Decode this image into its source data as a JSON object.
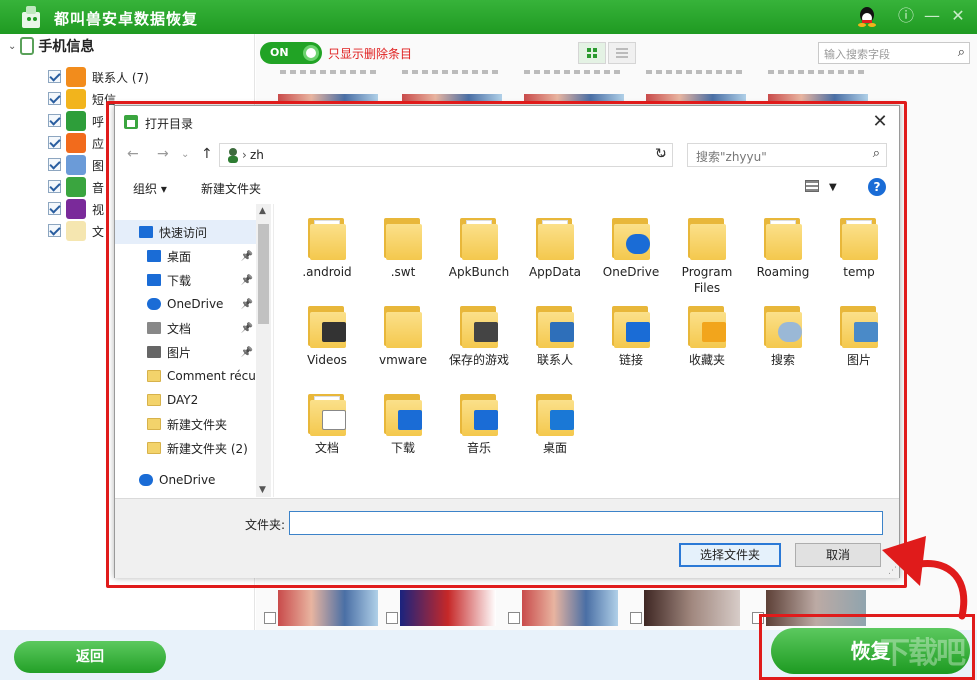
{
  "app": {
    "title": "都叫兽安卓数据恢复",
    "controls": [
      "ⓘ",
      "—",
      "✕"
    ]
  },
  "tree": {
    "root_label": "手机信息",
    "items": [
      {
        "label": "联系人 (7)",
        "color": "#f28c1c"
      },
      {
        "label": "短信",
        "color": "#f2b41c"
      },
      {
        "label": "呼",
        "color": "#2e9e3a"
      },
      {
        "label": "应",
        "color": "#f26b1c"
      },
      {
        "label": "图",
        "color": "#6b9bd8"
      },
      {
        "label": "音",
        "color": "#3aa53f"
      },
      {
        "label": "视",
        "color": "#7a2a9a"
      },
      {
        "label": "文",
        "color": "#f5e6b0"
      }
    ]
  },
  "main": {
    "toggle_text": "ON",
    "toggle_label": "只显示删除条目",
    "search_placeholder": "输入搜索字段"
  },
  "dialog": {
    "title": "打开目录",
    "path": "zh",
    "search_placeholder": "搜索\"zhyyu\"",
    "toolbar": {
      "organize": "组织 ▾",
      "new_folder": "新建文件夹"
    },
    "nav": [
      {
        "label": "快速访问",
        "icon": "star-icon",
        "pinned": false,
        "selected": true
      },
      {
        "label": "桌面",
        "icon": "desktop-icon",
        "pinned": true
      },
      {
        "label": "下载",
        "icon": "download-icon",
        "pinned": true
      },
      {
        "label": "OneDrive",
        "icon": "cloud-icon",
        "pinned": true
      },
      {
        "label": "文档",
        "icon": "document-icon",
        "pinned": true
      },
      {
        "label": "图片",
        "icon": "picture-icon",
        "pinned": true
      },
      {
        "label": "Comment récu",
        "icon": "folder-icon",
        "pinned": false
      },
      {
        "label": "DAY2",
        "icon": "folder-icon",
        "pinned": false
      },
      {
        "label": "新建文件夹",
        "icon": "folder-icon",
        "pinned": false
      },
      {
        "label": "新建文件夹 (2)",
        "icon": "folder-icon",
        "pinned": false
      },
      {
        "label": "OneDrive",
        "icon": "cloud-icon",
        "pinned": false
      }
    ],
    "files": [
      {
        "label": ".android",
        "overlay": "paper"
      },
      {
        "label": ".swt",
        "overlay": "none"
      },
      {
        "label": "ApkBunch",
        "overlay": "paper"
      },
      {
        "label": "AppData",
        "overlay": "paper"
      },
      {
        "label": "OneDrive",
        "overlay": "cloud"
      },
      {
        "label": "Program Files",
        "overlay": "none"
      },
      {
        "label": "Roaming",
        "overlay": "paper"
      },
      {
        "label": "temp",
        "overlay": "paper"
      },
      {
        "label": "Videos",
        "overlay": "film"
      },
      {
        "label": "vmware",
        "overlay": "none"
      },
      {
        "label": "保存的游戏",
        "overlay": "chess"
      },
      {
        "label": "联系人",
        "overlay": "card"
      },
      {
        "label": "链接",
        "overlay": "link"
      },
      {
        "label": "收藏夹",
        "overlay": "star"
      },
      {
        "label": "搜索",
        "overlay": "search"
      },
      {
        "label": "图片",
        "overlay": "picture"
      },
      {
        "label": "文档",
        "overlay": "doc"
      },
      {
        "label": "下载",
        "overlay": "download"
      },
      {
        "label": "音乐",
        "overlay": "music"
      },
      {
        "label": "桌面",
        "overlay": "desktop"
      }
    ],
    "folder_label": "文件夹:",
    "select_btn": "选择文件夹",
    "cancel_btn": "取消"
  },
  "bottom": {
    "back_label": "返回",
    "recover_label": "恢复",
    "watermark": "下载吧"
  },
  "colors": {
    "accent_green": "#21a325",
    "highlight_red": "#e01b1b"
  }
}
